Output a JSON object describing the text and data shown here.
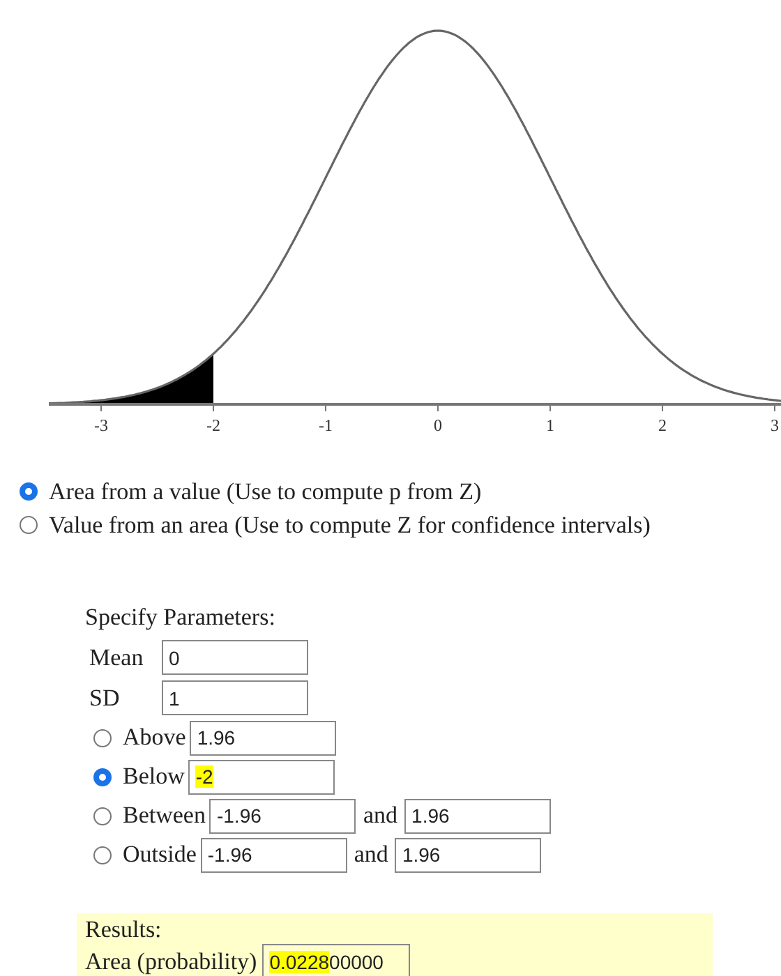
{
  "chart": {
    "x_ticks": [
      "-3",
      "-2",
      "-1",
      "0",
      "1",
      "2",
      "3"
    ]
  },
  "modes": [
    {
      "label": "Area from a value (Use to compute p from Z)",
      "selected": true
    },
    {
      "label": "Value from an area (Use to compute Z for confidence intervals)",
      "selected": false
    }
  ],
  "parameters": {
    "title": "Specify Parameters:",
    "fields": [
      {
        "label": "Mean",
        "value": "0"
      },
      {
        "label": "SD",
        "value": "1"
      }
    ],
    "options": [
      {
        "kind": "single",
        "label": "Above",
        "selected": false,
        "value_parts": [
          {
            "text": "1.96",
            "highlighted": false
          }
        ]
      },
      {
        "kind": "single",
        "label": "Below",
        "selected": true,
        "value_parts": [
          {
            "text": "-2",
            "highlighted": true
          }
        ]
      },
      {
        "kind": "range",
        "label": "Between",
        "selected": false,
        "value_parts": [
          {
            "text": "-1.96",
            "highlighted": false
          }
        ],
        "joiner": "and",
        "value2": "1.96"
      },
      {
        "kind": "range",
        "label": "Outside",
        "selected": false,
        "value_parts": [
          {
            "text": "-1.96",
            "highlighted": false
          }
        ],
        "joiner": "and",
        "value2": "1.96"
      }
    ]
  },
  "results": {
    "title": "Results:",
    "label": "Area (probability)",
    "value_parts": [
      {
        "text": "0.0228",
        "highlighted": true
      },
      {
        "text": "00000",
        "highlighted": false
      }
    ]
  }
}
